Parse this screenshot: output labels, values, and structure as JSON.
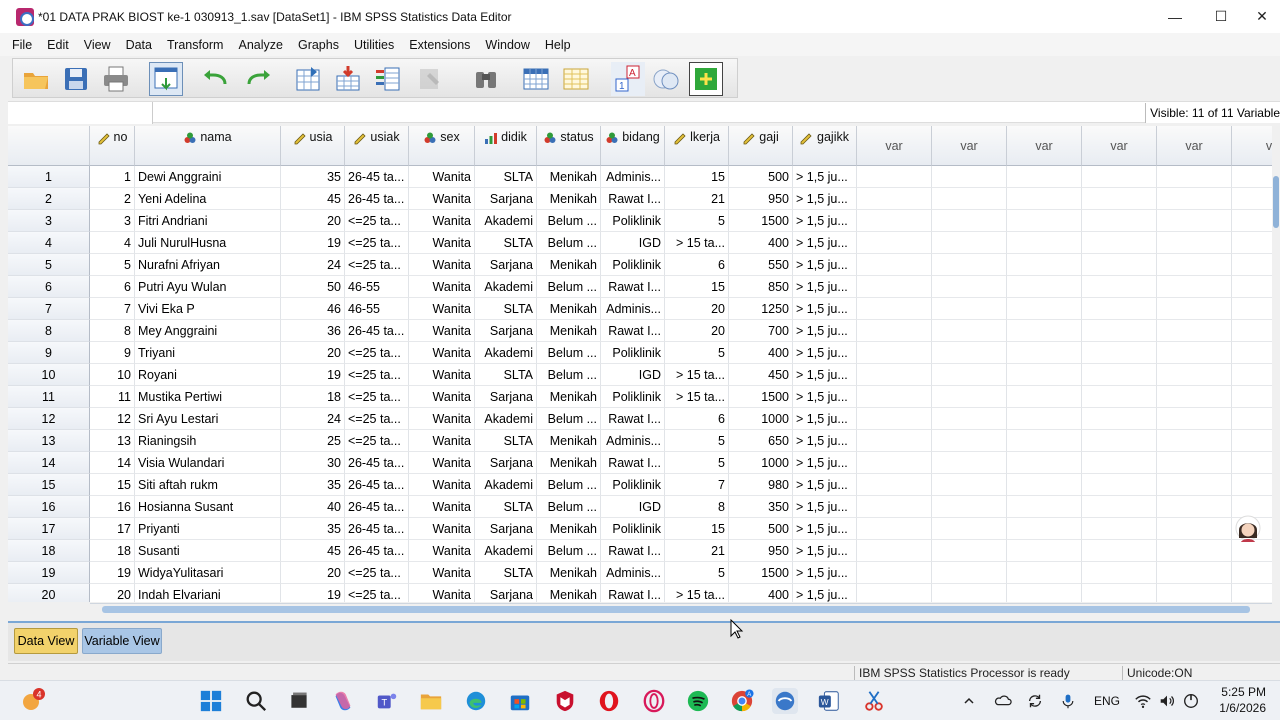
{
  "window": {
    "title": "*01 DATA PRAK BIOST ke-1 030913_1.sav [DataSet1] - IBM SPSS Statistics Data Editor",
    "minimize": "—",
    "maximize": "☐",
    "close": "✕"
  },
  "menu": [
    "File",
    "Edit",
    "View",
    "Data",
    "Transform",
    "Analyze",
    "Graphs",
    "Utilities",
    "Extensions",
    "Window",
    "Help"
  ],
  "toolbar": {
    "icons": [
      "open-folder-icon",
      "save-icon",
      "print-icon",
      "recall-dialog-icon",
      "undo-icon",
      "redo-icon",
      "go-to-case-icon",
      "go-to-variable-icon",
      "variables-icon",
      "run-descriptives-icon",
      "find-icon",
      "insert-cases-icon",
      "insert-variable-icon",
      "split-file-icon",
      "value-labels-icon",
      "use-sets-icon",
      "spelling-icon"
    ]
  },
  "edit_line": {
    "cell_name": "",
    "value": "",
    "visible": "Visible: 11 of 11 Variable"
  },
  "grid": {
    "columns": [
      {
        "name": "no",
        "type": "scale",
        "align": "r"
      },
      {
        "name": "nama",
        "type": "nominal",
        "align": "l"
      },
      {
        "name": "usia",
        "type": "scale",
        "align": "r"
      },
      {
        "name": "usiak",
        "type": "scale",
        "align": "l"
      },
      {
        "name": "sex",
        "type": "nominal",
        "align": "r"
      },
      {
        "name": "didik",
        "type": "ordinal",
        "align": "r"
      },
      {
        "name": "status",
        "type": "nominal",
        "align": "r"
      },
      {
        "name": "bidang",
        "type": "nominal",
        "align": "r"
      },
      {
        "name": "lkerja",
        "type": "scale",
        "align": "r"
      },
      {
        "name": "gaji",
        "type": "scale",
        "align": "r"
      },
      {
        "name": "gajikk",
        "type": "scale",
        "align": "l"
      }
    ],
    "var_columns": [
      "var",
      "var",
      "var",
      "var",
      "var",
      "v"
    ],
    "row_numbers": [
      "1",
      "2",
      "3",
      "4",
      "5",
      "6",
      "7",
      "8",
      "9",
      "10",
      "11",
      "12",
      "13",
      "14",
      "15",
      "16",
      "17",
      "18",
      "19",
      "20"
    ],
    "rows": [
      [
        "1",
        "Dewi Anggraini",
        "35",
        "26-45 ta...",
        "Wanita",
        "SLTA",
        "Menikah",
        "Adminis...",
        "15",
        "500",
        "> 1,5 ju..."
      ],
      [
        "2",
        "Yeni Adelina",
        "45",
        "26-45 ta...",
        "Wanita",
        "Sarjana",
        "Menikah",
        "Rawat I...",
        "21",
        "950",
        "> 1,5 ju..."
      ],
      [
        "3",
        "Fitri Andriani",
        "20",
        "<=25 ta...",
        "Wanita",
        "Akademi",
        "Belum ...",
        "Poliklinik",
        "5",
        "1500",
        "> 1,5 ju..."
      ],
      [
        "4",
        "Juli NurulHusna",
        "19",
        "<=25 ta...",
        "Wanita",
        "SLTA",
        "Belum ...",
        "IGD",
        "> 15 ta...",
        "400",
        "> 1,5 ju..."
      ],
      [
        "5",
        "Nurafni Afriyan",
        "24",
        "<=25 ta...",
        "Wanita",
        "Sarjana",
        "Menikah",
        "Poliklinik",
        "6",
        "550",
        "> 1,5 ju..."
      ],
      [
        "6",
        "Putri Ayu Wulan",
        "50",
        "46-55",
        "Wanita",
        "Akademi",
        "Belum ...",
        "Rawat I...",
        "15",
        "850",
        "> 1,5 ju..."
      ],
      [
        "7",
        "Vivi Eka P",
        "46",
        "46-55",
        "Wanita",
        "SLTA",
        "Menikah",
        "Adminis...",
        "20",
        "1250",
        "> 1,5 ju..."
      ],
      [
        "8",
        "Mey Anggraini",
        "36",
        "26-45 ta...",
        "Wanita",
        "Sarjana",
        "Menikah",
        "Rawat I...",
        "20",
        "700",
        "> 1,5 ju..."
      ],
      [
        "9",
        "Triyani",
        "20",
        "<=25 ta...",
        "Wanita",
        "Akademi",
        "Belum ...",
        "Poliklinik",
        "5",
        "400",
        "> 1,5 ju..."
      ],
      [
        "10",
        "Royani",
        "19",
        "<=25 ta...",
        "Wanita",
        "SLTA",
        "Belum ...",
        "IGD",
        "> 15 ta...",
        "450",
        "> 1,5 ju..."
      ],
      [
        "11",
        "Mustika Pertiwi",
        "18",
        "<=25 ta...",
        "Wanita",
        "Sarjana",
        "Menikah",
        "Poliklinik",
        "> 15 ta...",
        "1500",
        "> 1,5 ju..."
      ],
      [
        "12",
        "Sri Ayu Lestari",
        "24",
        "<=25 ta...",
        "Wanita",
        "Akademi",
        "Belum ...",
        "Rawat I...",
        "6",
        "1000",
        "> 1,5 ju..."
      ],
      [
        "13",
        "Rianingsih",
        "25",
        "<=25 ta...",
        "Wanita",
        "SLTA",
        "Menikah",
        "Adminis...",
        "5",
        "650",
        "> 1,5 ju..."
      ],
      [
        "14",
        "Visia Wulandari",
        "30",
        "26-45 ta...",
        "Wanita",
        "Sarjana",
        "Menikah",
        "Rawat I...",
        "5",
        "1000",
        "> 1,5 ju..."
      ],
      [
        "15",
        "Siti aftah rukm",
        "35",
        "26-45 ta...",
        "Wanita",
        "Akademi",
        "Belum ...",
        "Poliklinik",
        "7",
        "980",
        "> 1,5 ju..."
      ],
      [
        "16",
        "Hosianna Susant",
        "40",
        "26-45 ta...",
        "Wanita",
        "SLTA",
        "Belum ...",
        "IGD",
        "8",
        "350",
        "> 1,5 ju..."
      ],
      [
        "17",
        "Priyanti",
        "35",
        "26-45 ta...",
        "Wanita",
        "Sarjana",
        "Menikah",
        "Poliklinik",
        "15",
        "500",
        "> 1,5 ju..."
      ],
      [
        "18",
        "Susanti",
        "45",
        "26-45 ta...",
        "Wanita",
        "Akademi",
        "Belum ...",
        "Rawat I...",
        "21",
        "950",
        "> 1,5 ju..."
      ],
      [
        "19",
        "WidyaYulitasari",
        "20",
        "<=25 ta...",
        "Wanita",
        "SLTA",
        "Menikah",
        "Adminis...",
        "5",
        "1500",
        "> 1,5 ju..."
      ],
      [
        "20",
        "Indah Elvariani",
        "19",
        "<=25 ta...",
        "Wanita",
        "Sarjana",
        "Menikah",
        "Rawat I...",
        "> 15 ta...",
        "400",
        "> 1,5 ju..."
      ]
    ]
  },
  "tabs": {
    "data_view": "Data View",
    "variable_view": "Variable View"
  },
  "status": {
    "processor": "IBM SPSS Statistics Processor is ready",
    "unicode": "Unicode:ON"
  },
  "taskbar": {
    "weather_badge": "4",
    "lang": "ENG",
    "time": "5:25 PM",
    "date": "1/6/2026",
    "chrome_badge": "A"
  },
  "colors": {
    "accent": "#3a78c9",
    "tab_active": "#f2d26b",
    "tab_inactive": "#a9c6e6"
  }
}
